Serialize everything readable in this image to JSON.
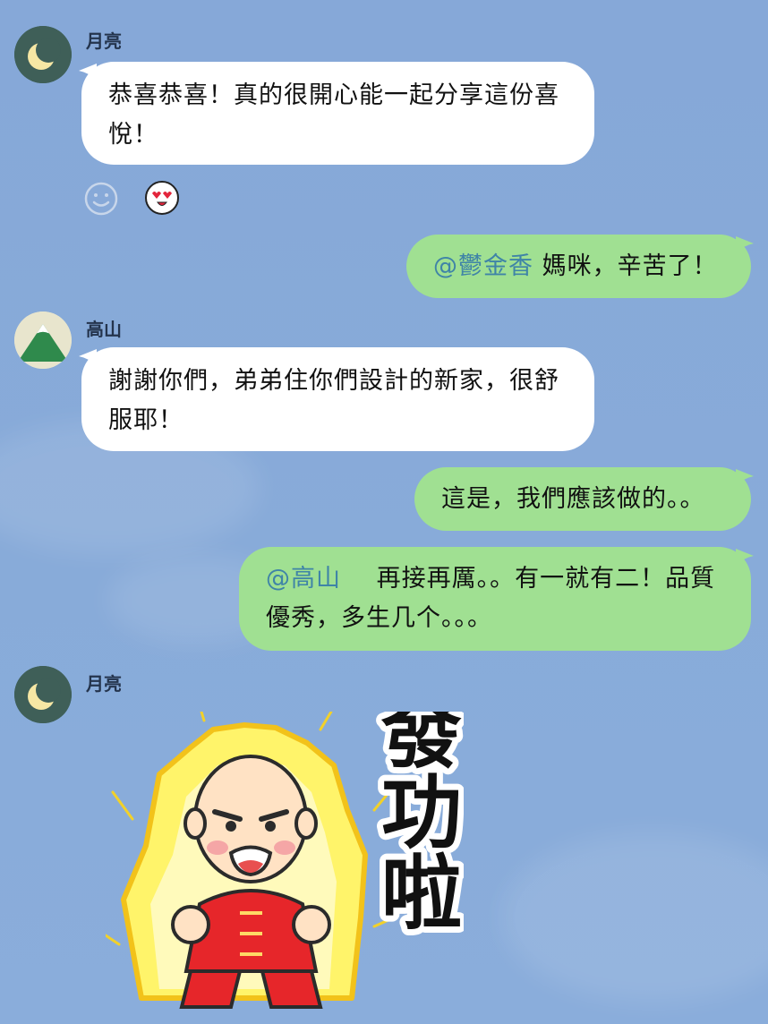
{
  "chat": {
    "messages": [
      {
        "sender": "月亮",
        "text": "恭喜恭喜！真的很開心能一起分享這份喜悅！"
      },
      {
        "mention": "@鬱金香",
        "text": "媽咪，辛苦了！"
      },
      {
        "sender": "高山",
        "text": "謝謝你們，弟弟住你們設計的新家，很舒服耶！"
      },
      {
        "text": "這是，我們應該做的。。"
      },
      {
        "mention": "@高山",
        "text": "再接再厲。。有一就有二！品質優秀，多生几个。。。"
      },
      {
        "sender": "月亮",
        "sticker_text": "發功啦"
      }
    ]
  },
  "reactions": {
    "smile": "smile-reaction-icon",
    "love": "heart-eyes-reaction-icon"
  },
  "colors": {
    "background": "#87a9d9",
    "incoming_bubble": "#ffffff",
    "outgoing_bubble": "#a0e092",
    "mention": "#3f84a7"
  }
}
